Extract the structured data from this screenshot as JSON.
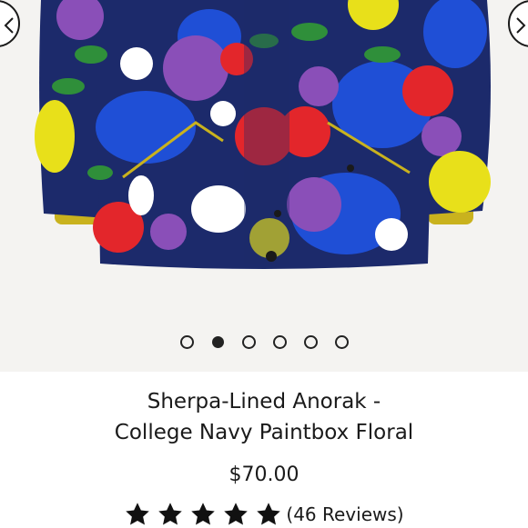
{
  "gallery": {
    "prev_icon": "chevron-left-icon",
    "next_icon": "chevron-right-icon",
    "dots": [
      {
        "state": "inactive"
      },
      {
        "state": "active"
      },
      {
        "state": "inactive"
      },
      {
        "state": "inactive"
      },
      {
        "state": "inactive"
      },
      {
        "state": "inactive"
      }
    ],
    "active_index": 1
  },
  "product": {
    "title_line1": "Sherpa-Lined Anorak -",
    "title_line2": "College Navy Paintbox Floral",
    "price": "$70.00",
    "rating_value": 5,
    "rating_max": 5,
    "reviews_label": "(46 Reviews)"
  },
  "colors": {
    "navy": "#1c2a6b",
    "blue": "#1f4fd6",
    "purple": "#8a4fb8",
    "red": "#e3262b",
    "yellow": "#e8e01a",
    "green": "#2f8f3a",
    "mustard": "#c9b21e",
    "star": "#111111"
  }
}
